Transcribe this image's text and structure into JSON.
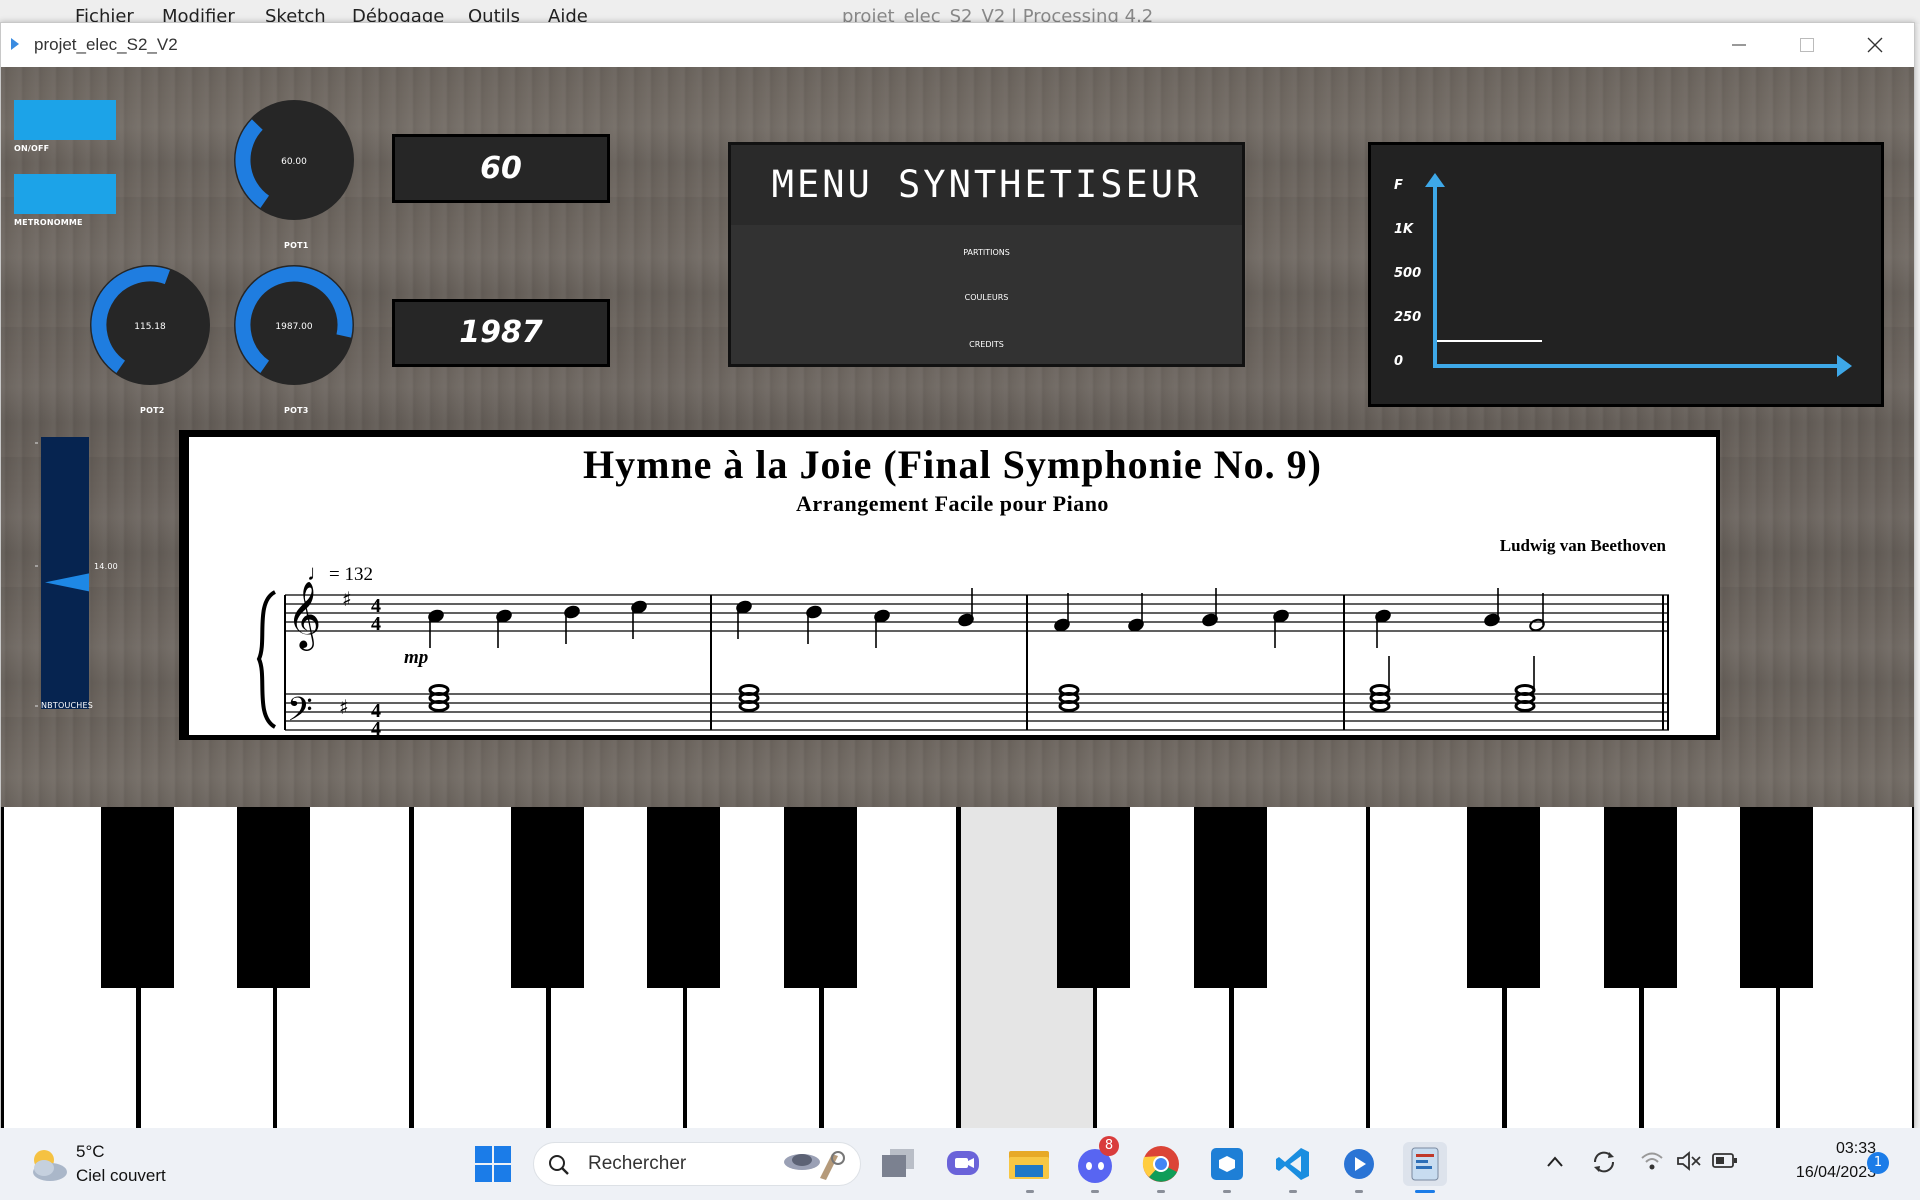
{
  "background_menubar": {
    "items": [
      "Fichier",
      "Modifier",
      "Sketch",
      "Débogage",
      "Outils",
      "Aide"
    ],
    "title": "projet_elec_S2_V2 | Processing 4.2"
  },
  "window": {
    "title": "projet_elec_S2_V2"
  },
  "controls": {
    "onoff_label": "ON/OFF",
    "metronome_label": "METRONOMME",
    "pot1": {
      "label": "POT1",
      "value_text": "60.00",
      "fraction": 0.3
    },
    "pot2": {
      "label": "POT2",
      "value_text": "115.18",
      "fraction": 0.5
    },
    "pot3": {
      "label": "POT3",
      "value_text": "1987.00",
      "fraction": 0.75
    },
    "display1": "60",
    "display2": "1987",
    "slider": {
      "label": "NBTOUCHES",
      "value_text": "14.00",
      "fraction": 0.47
    }
  },
  "menu": {
    "title": "MENU SYNTHETISEUR",
    "items": [
      "PARTITIONS",
      "COULEURS",
      "CREDITS"
    ]
  },
  "spectrum": {
    "y_labels": [
      "F",
      "1K",
      "500",
      "250",
      "0"
    ],
    "accent": "#3ea8e8"
  },
  "sheet_music": {
    "title": "Hymne à la Joie (Final Symphonie No. 9)",
    "subtitle": "Arrangement Facile pour Piano",
    "composer": "Ludwig van Beethoven",
    "tempo": "= 132",
    "dynamic": "mp",
    "time_signature": "4/4",
    "key": "G major (1 sharp)"
  },
  "keyboard": {
    "white_keys": 14,
    "pressed_white_key_index": 7,
    "pressed_color": "#e5e5e5"
  },
  "taskbar": {
    "weather_temp": "5°C",
    "weather_desc": "Ciel couvert",
    "search_placeholder": "Rechercher",
    "discord_badge": "8",
    "time": "03:33",
    "date": "16/04/2023",
    "notification_count": "1"
  }
}
